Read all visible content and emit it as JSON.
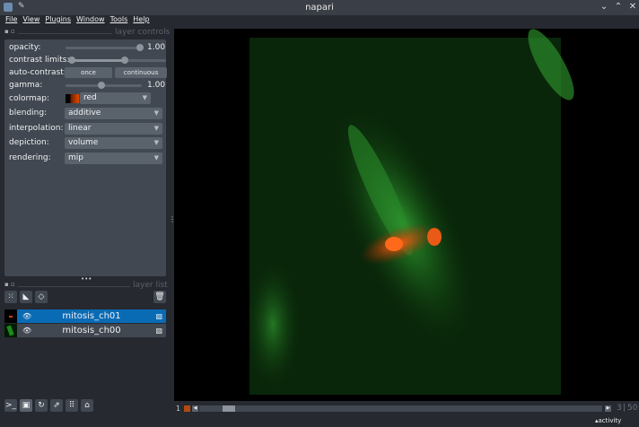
{
  "window": {
    "title": "napari",
    "min": "⌄",
    "max": "⌃",
    "close": "✕"
  },
  "menu": [
    "File",
    "View",
    "Plugins",
    "Window",
    "Tools",
    "Help"
  ],
  "layer_controls": {
    "title": "layer controls",
    "opacity_label": "opacity:",
    "opacity_value": "1.00",
    "opacity": 1.0,
    "contrast_label": "contrast limits:",
    "contrast_range": [
      0.0,
      0.58
    ],
    "autocontrast_label": "auto-contrast:",
    "once": "once",
    "continuous": "continuous",
    "gamma_label": "gamma:",
    "gamma_value": "1.00",
    "gamma_fraction": 0.45,
    "colormap_label": "colormap:",
    "colormap": "red",
    "blending_label": "blending:",
    "blending": "additive",
    "interpolation_label": "interpolation:",
    "interpolation": "linear",
    "depiction_label": "depiction:",
    "depiction": "volume",
    "rendering_label": "rendering:",
    "rendering": "mip"
  },
  "layer_list": {
    "title": "layer list",
    "layers": [
      {
        "name": "mitosis_ch01",
        "selected": true
      },
      {
        "name": "mitosis_ch00",
        "selected": false
      }
    ]
  },
  "dims": {
    "axis": "1",
    "current": "3",
    "total": "50",
    "position_fraction": 0.06
  },
  "status": {
    "activity": "activity"
  }
}
